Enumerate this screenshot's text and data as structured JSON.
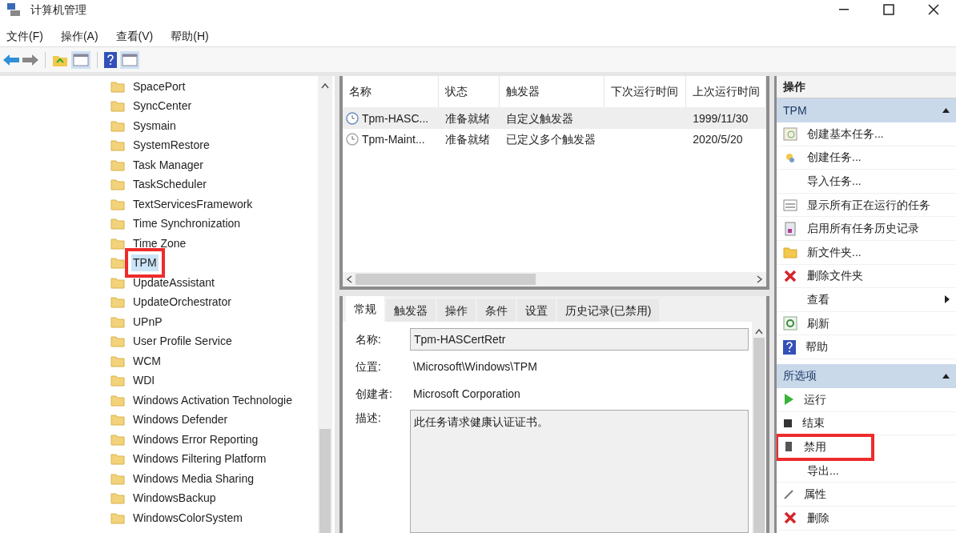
{
  "window": {
    "title": "计算机管理"
  },
  "menu": [
    "文件(F)",
    "操作(A)",
    "查看(V)",
    "帮助(H)"
  ],
  "tree": {
    "items": [
      {
        "label": "SpacePort",
        "selected": false,
        "highlighted": false
      },
      {
        "label": "SyncCenter",
        "selected": false,
        "highlighted": false
      },
      {
        "label": "Sysmain",
        "selected": false,
        "highlighted": false
      },
      {
        "label": "SystemRestore",
        "selected": false,
        "highlighted": false
      },
      {
        "label": "Task Manager",
        "selected": false,
        "highlighted": false
      },
      {
        "label": "TaskScheduler",
        "selected": false,
        "highlighted": false
      },
      {
        "label": "TextServicesFramework",
        "selected": false,
        "highlighted": false
      },
      {
        "label": "Time Synchronization",
        "selected": false,
        "highlighted": false
      },
      {
        "label": "Time Zone",
        "selected": false,
        "highlighted": false
      },
      {
        "label": "TPM",
        "selected": true,
        "highlighted": true
      },
      {
        "label": "UpdateAssistant",
        "selected": false,
        "highlighted": false
      },
      {
        "label": "UpdateOrchestrator",
        "selected": false,
        "highlighted": false
      },
      {
        "label": "UPnP",
        "selected": false,
        "highlighted": false
      },
      {
        "label": "User Profile Service",
        "selected": false,
        "highlighted": false
      },
      {
        "label": "WCM",
        "selected": false,
        "highlighted": false
      },
      {
        "label": "WDI",
        "selected": false,
        "highlighted": false
      },
      {
        "label": "Windows Activation Technologie",
        "selected": false,
        "highlighted": false
      },
      {
        "label": "Windows Defender",
        "selected": false,
        "highlighted": false
      },
      {
        "label": "Windows Error Reporting",
        "selected": false,
        "highlighted": false
      },
      {
        "label": "Windows Filtering Platform",
        "selected": false,
        "highlighted": false
      },
      {
        "label": "Windows Media Sharing",
        "selected": false,
        "highlighted": false
      },
      {
        "label": "WindowsBackup",
        "selected": false,
        "highlighted": false
      },
      {
        "label": "WindowsColorSystem",
        "selected": false,
        "highlighted": false
      }
    ]
  },
  "task_list": {
    "columns": [
      "名称",
      "状态",
      "触发器",
      "下次运行时间",
      "上次运行时间"
    ],
    "rows": [
      {
        "name": "Tpm-HASC...",
        "status": "准备就绪",
        "trigger": "自定义触发器",
        "last_run": "1999/11/30",
        "selected": true
      },
      {
        "name": "Tpm-Maint...",
        "status": "准备就绪",
        "trigger": "已定义多个触发器",
        "last_run": "2020/5/20",
        "selected": false
      }
    ]
  },
  "details": {
    "tabs": [
      {
        "label": "常规",
        "selected": true
      },
      {
        "label": "触发器",
        "selected": false
      },
      {
        "label": "操作",
        "selected": false
      },
      {
        "label": "条件",
        "selected": false
      },
      {
        "label": "设置",
        "selected": false
      },
      {
        "label": "历史记录(已禁用)",
        "selected": false
      }
    ],
    "fields": [
      {
        "label": "名称:",
        "value": "Tpm-HASCertRetr",
        "kind": "input"
      },
      {
        "label": "位置:",
        "value": "\\Microsoft\\Windows\\TPM",
        "kind": "text"
      },
      {
        "label": "创建者:",
        "value": "Microsoft Corporation",
        "kind": "text"
      },
      {
        "label": "描述:",
        "value": "此任务请求健康认证证书。",
        "kind": "textarea"
      }
    ]
  },
  "actions": {
    "title": "操作",
    "sections": [
      {
        "title": "TPM",
        "items": [
          {
            "label": "创建基本任务...",
            "kind": "calendar",
            "submenu": false,
            "highlighted": false
          },
          {
            "label": "创建任务...",
            "kind": "task",
            "submenu": false,
            "highlighted": false
          },
          {
            "label": "导入任务...",
            "kind": "plain",
            "submenu": false,
            "highlighted": false
          },
          {
            "label": "显示所有正在运行的任务",
            "kind": "list",
            "submenu": false,
            "highlighted": false
          },
          {
            "label": "启用所有任务历史记录",
            "kind": "history",
            "submenu": false,
            "highlighted": false
          },
          {
            "label": "新文件夹...",
            "kind": "folder",
            "submenu": false,
            "highlighted": false
          },
          {
            "label": "删除文件夹",
            "kind": "delete",
            "submenu": false,
            "highlighted": false
          },
          {
            "label": "查看",
            "kind": "plain",
            "submenu": true,
            "highlighted": false
          },
          {
            "label": "刷新",
            "kind": "refresh",
            "submenu": false,
            "highlighted": false
          },
          {
            "label": "帮助",
            "kind": "help",
            "submenu": false,
            "highlighted": false
          }
        ]
      },
      {
        "title": "所选项",
        "items": [
          {
            "label": "运行",
            "kind": "run",
            "submenu": false,
            "highlighted": false
          },
          {
            "label": "结束",
            "kind": "stop",
            "submenu": false,
            "highlighted": false
          },
          {
            "label": "禁用",
            "kind": "disable",
            "submenu": false,
            "highlighted": true
          },
          {
            "label": "导出...",
            "kind": "plain",
            "submenu": false,
            "highlighted": false
          },
          {
            "label": "属性",
            "kind": "properties",
            "submenu": false,
            "highlighted": false
          },
          {
            "label": "删除",
            "kind": "delete",
            "submenu": false,
            "highlighted": false
          }
        ]
      }
    ]
  }
}
